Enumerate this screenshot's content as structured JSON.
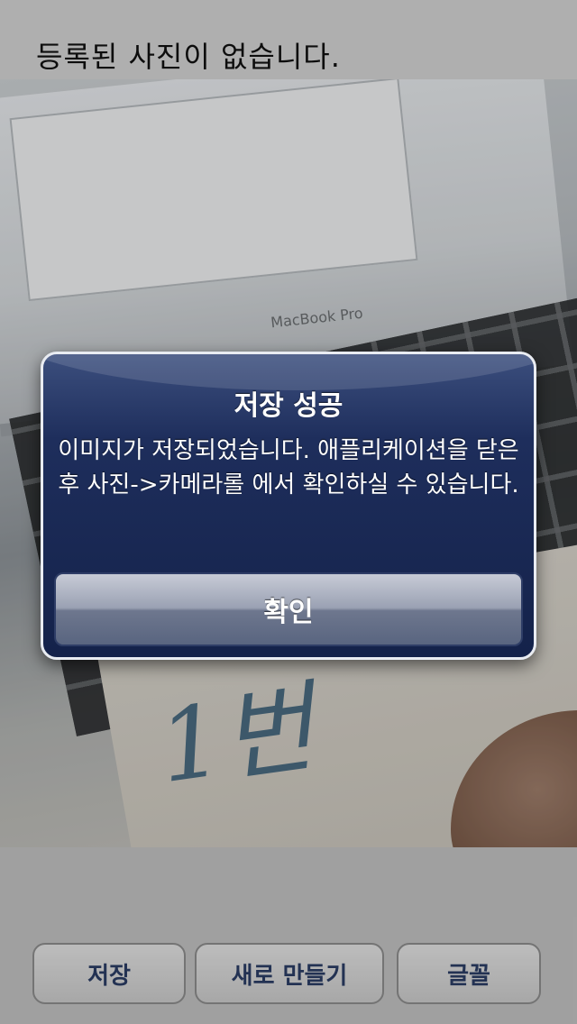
{
  "header": {
    "text": "등록된 사진이 없습니다."
  },
  "photo": {
    "brand_text": "MacBook Pro",
    "handwriting": "1번"
  },
  "alert": {
    "title": "저장 성공",
    "message": "이미지가 저장되었습니다. 애플리케이션을 닫은 후 사진->카메라롤 에서 확인하실 수 있습니다.",
    "ok_label": "확인"
  },
  "toolbar": {
    "save_label": "저장",
    "new_label": "새로 만들기",
    "font_label": "글꼴",
    "text_color": "#2b3e66"
  },
  "colors": {
    "alert_bg": "#1e2e5c",
    "alert_border": "#e9ecf2"
  }
}
